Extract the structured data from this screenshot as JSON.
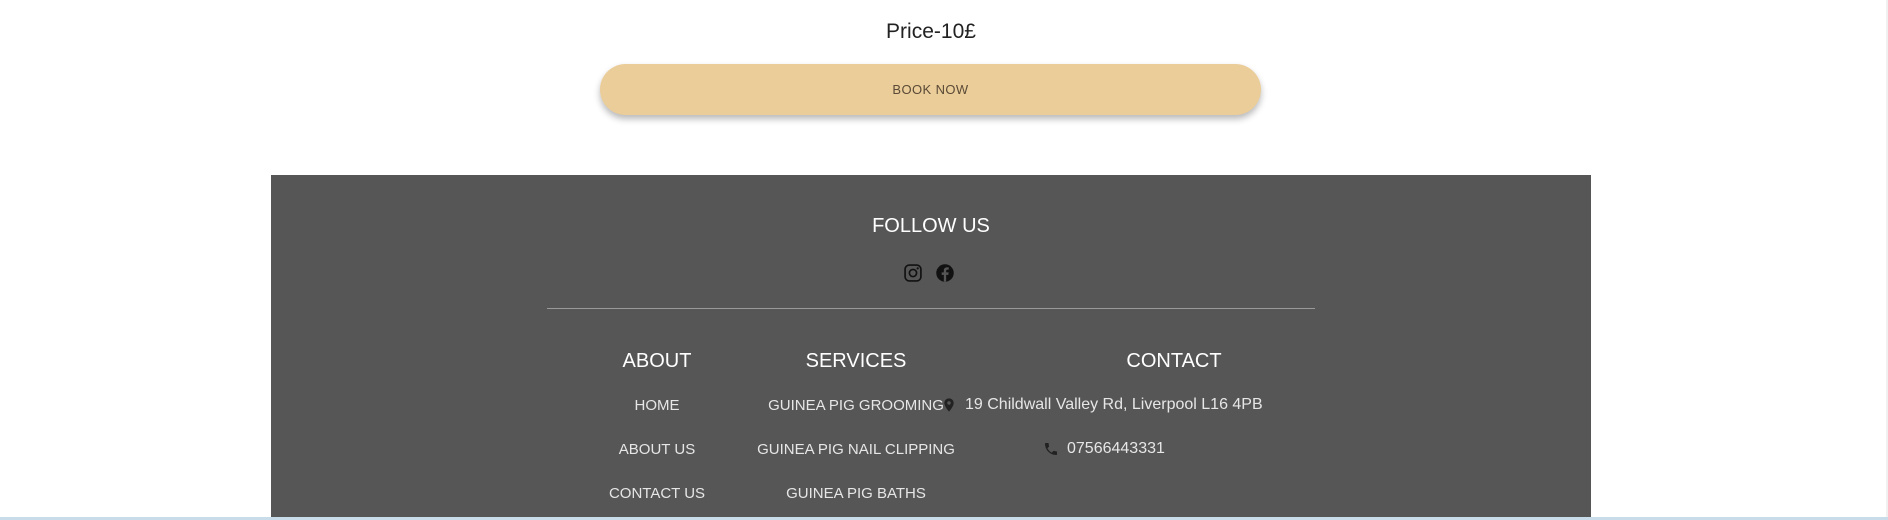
{
  "product": {
    "price": "Price-10£",
    "book_label": "BOOK NOW"
  },
  "footer": {
    "follow_title": "FOLLOW US",
    "social": [
      {
        "name": "Instagram",
        "icon": "instagram-icon"
      },
      {
        "name": "Facebook",
        "icon": "facebook-icon"
      }
    ],
    "about": {
      "title": "ABOUT",
      "links": [
        "HOME",
        "ABOUT US",
        "CONTACT US"
      ]
    },
    "services": {
      "title": "SERVICES",
      "links": [
        "GUINEA PIG GROOMING",
        "GUINEA PIG NAIL CLIPPING",
        "GUINEA PIG BATHS"
      ]
    },
    "contact": {
      "title": "CONTACT",
      "address": "19 Childwall Valley Rd, Liverpool L16 4PB",
      "phone": "07566443331",
      "address_icon": "location-pin-icon",
      "phone_icon": "phone-icon"
    }
  },
  "colors": {
    "button": "#ebcd9a",
    "footer_bg": "#565656",
    "page_bg": "#ffffff"
  }
}
